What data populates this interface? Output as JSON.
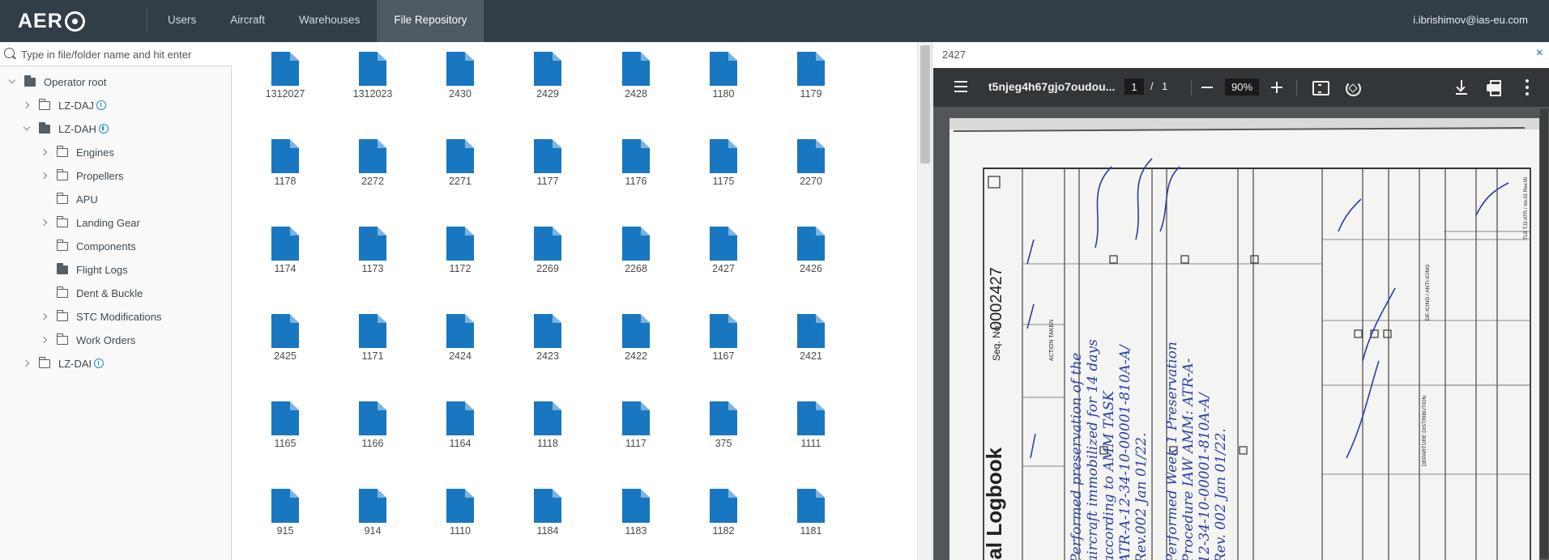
{
  "app": {
    "logo": "AER"
  },
  "nav": {
    "items": [
      "Users",
      "Aircraft",
      "Warehouses",
      "File Repository"
    ],
    "active": "File Repository",
    "user_email": "i.ibrishimov@ias-eu.com"
  },
  "tree": {
    "search_placeholder": "Type in file/folder name and hit enter",
    "items": [
      {
        "label": "Operator root",
        "chevron": "down",
        "folder": "filled"
      },
      {
        "label": "LZ-DAJ",
        "chevron": "right",
        "folder": "outline",
        "cloud": true
      },
      {
        "label": "LZ-DAH",
        "chevron": "down",
        "folder": "filled",
        "cloud": true
      },
      {
        "label": "Engines",
        "chevron": "right",
        "folder": "outline"
      },
      {
        "label": "Propellers",
        "chevron": "right",
        "folder": "outline"
      },
      {
        "label": "APU",
        "chevron": "none",
        "folder": "outline"
      },
      {
        "label": "Landing Gear",
        "chevron": "right",
        "folder": "outline"
      },
      {
        "label": "Components",
        "chevron": "none",
        "folder": "outline"
      },
      {
        "label": "Flight Logs",
        "chevron": "none",
        "folder": "filled"
      },
      {
        "label": "Dent & Buckle",
        "chevron": "none",
        "folder": "outline"
      },
      {
        "label": "STC Modifications",
        "chevron": "right",
        "folder": "outline"
      },
      {
        "label": "Work Orders",
        "chevron": "right",
        "folder": "outline"
      },
      {
        "label": "LZ-DAI",
        "chevron": "right",
        "folder": "outline",
        "cloud": true
      }
    ]
  },
  "files": [
    "1312027",
    "1312023",
    "2430",
    "2429",
    "2428",
    "1180",
    "1179",
    "1178",
    "2272",
    "2271",
    "1177",
    "1176",
    "1175",
    "2270",
    "1174",
    "1173",
    "1172",
    "2269",
    "2268",
    "2427",
    "2426",
    "2425",
    "1171",
    "2424",
    "2423",
    "2422",
    "1167",
    "2421",
    "1165",
    "1166",
    "1164",
    "1118",
    "1117",
    "375",
    "1111",
    "915",
    "914",
    "1110",
    "1184",
    "1183",
    "1182",
    "1181"
  ],
  "preview": {
    "title": "2427",
    "close": "×",
    "pdf": {
      "filename": "t5njeg4h67gjo7oudou...",
      "page_current": "1",
      "page_separator": "/",
      "page_total": "1",
      "zoom": "90%"
    },
    "scan": {
      "heading": "cal Logbook",
      "seq_label": "Seq. No:",
      "seq_number": "0002427",
      "col_action_taken": "ACTION TAKEN",
      "col_tlb": "TLB TJ2-ATR / Iss.01 Rev.00",
      "col_departure": "DEPARTURE DISTRIBUTION",
      "col_deicing": "DE-ICING / ANTI-ICING",
      "hw_1": "Performed preservation of the",
      "hw_2": "aircraft immobilized for 14 days",
      "hw_3": "according to AMM TASK",
      "hw_4": "ATR-A-12-34-10-00001-810A-A/",
      "hw_5": "Rev.002 Jan 01/22.",
      "hw_6": "Performed Week 1 Preservation",
      "hw_7": "Procedure IAW AMM: ATR-A-",
      "hw_8": "12-34-10-00001-810A-A/",
      "hw_9": "Rev. 002 Jan 01/22."
    }
  }
}
